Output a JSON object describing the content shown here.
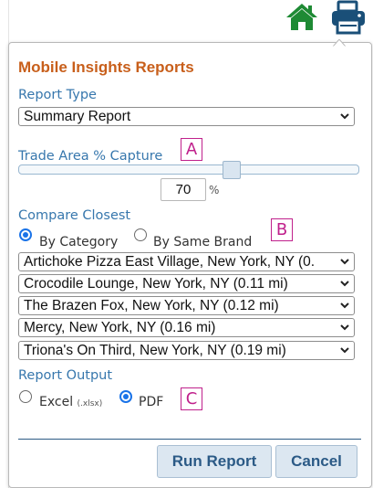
{
  "toolbar": {
    "home_icon": "home-icon",
    "print_icon": "printer-icon"
  },
  "colors": {
    "title": "#c85f1b",
    "label": "#3777ad",
    "callout": "#c0218c",
    "icon_green": "#1e8a34",
    "icon_blue": "#1a4f78"
  },
  "panel": {
    "title": "Mobile Insights Reports",
    "report_type": {
      "label": "Report Type",
      "value": "Summary Report"
    },
    "trade_area": {
      "label": "Trade Area % Capture",
      "value": "70",
      "unit": "%",
      "slider_level_percent": 62
    },
    "compare": {
      "label": "Compare Closest",
      "options": [
        "By Category",
        "By Same Brand"
      ],
      "selected": "By Category",
      "locations": [
        "Artichoke Pizza East Village, New York, NY (0.",
        "Crocodile Lounge, New York, NY (0.11 mi)",
        "The Brazen Fox, New York, NY (0.12 mi)",
        "Mercy, New York, NY (0.16 mi)",
        "Triona's On Third, New York, NY (0.19 mi)"
      ]
    },
    "output": {
      "label": "Report Output",
      "excel_label": "Excel",
      "excel_ext": "(.xlsx)",
      "pdf_label": "PDF",
      "selected": "PDF"
    },
    "buttons": {
      "run": "Run Report",
      "cancel": "Cancel"
    }
  },
  "callouts": {
    "a": "A",
    "b": "B",
    "c": "C"
  }
}
